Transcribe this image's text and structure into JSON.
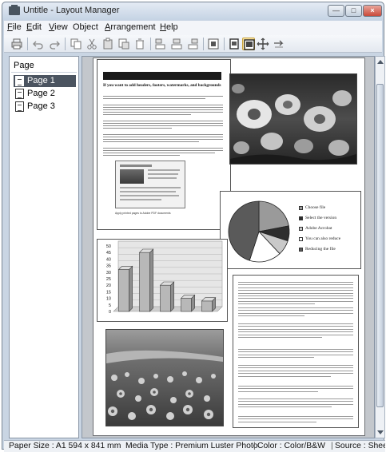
{
  "window": {
    "title": "Untitle - Layout Manager",
    "controls": [
      "min",
      "max",
      "close"
    ]
  },
  "menu": {
    "items": [
      {
        "label": "File",
        "hotkey": "F",
        "rest": "ile"
      },
      {
        "label": "Edit",
        "hotkey": "E",
        "rest": "dit"
      },
      {
        "label": "View",
        "hotkey": "V",
        "rest": "iew"
      },
      {
        "label": "Object",
        "hotkey": "",
        "rest": "Object",
        "hotkey_after": "j"
      },
      {
        "label": "Arrangement",
        "hotkey": "A",
        "rest": "rrangement"
      },
      {
        "label": "Help",
        "hotkey": "H",
        "rest": "elp"
      }
    ]
  },
  "toolbar": {
    "buttons": [
      {
        "name": "print-icon",
        "active": false
      },
      {
        "name": "undo-icon",
        "active": false
      },
      {
        "name": "redo-icon",
        "active": false
      },
      {
        "name": "copy-icon",
        "active": false
      },
      {
        "name": "cut-icon",
        "active": false
      },
      {
        "name": "paste-icon",
        "active": false
      },
      {
        "name": "paste-special-icon",
        "active": false
      },
      {
        "name": "delete-icon",
        "active": false
      },
      {
        "name": "align-left-icon",
        "active": false
      },
      {
        "name": "align-center-icon",
        "active": false
      },
      {
        "name": "align-right-icon",
        "active": false
      },
      {
        "name": "fit-page-icon",
        "active": false
      },
      {
        "name": "page-view-icon",
        "active": false
      },
      {
        "name": "layout-view-icon",
        "active": true
      },
      {
        "name": "zoom-icon",
        "active": false
      },
      {
        "name": "pan-icon",
        "active": false
      }
    ]
  },
  "sidebar": {
    "title": "Page",
    "pages": [
      {
        "label": "Page 1",
        "selected": true
      },
      {
        "label": "Page 2",
        "selected": false
      },
      {
        "label": "Page 3",
        "selected": false
      }
    ]
  },
  "document": {
    "heading": "If you want to add headers, footers, watermarks, and backgrounds",
    "caption": "Apply printed pages to Adobe PDF documents",
    "pie_legend": [
      "Choose file",
      "Select the version",
      "Adobe Acrobat",
      "You can also reduce",
      "Reducing the file"
    ],
    "colors": {
      "pie": [
        "#9a9a9a",
        "#2e2e2e",
        "#c9c9c9",
        "#ffffff",
        "#5a5a5a"
      ],
      "bars": "#b8b8b8"
    }
  },
  "chart_data": {
    "type": "bar",
    "categories": [
      "1",
      "2",
      "3",
      "4",
      "5"
    ],
    "values": [
      32,
      45,
      20,
      10,
      8
    ],
    "title": "",
    "xlabel": "",
    "ylabel": "",
    "ylim": [
      0,
      50
    ],
    "yticks": [
      0,
      5,
      10,
      15,
      20,
      25,
      30,
      35,
      40,
      45,
      50
    ],
    "grid": true,
    "legend": "none"
  },
  "statusbar": {
    "paper_size": "Paper Size : A1 594 x 841 mm",
    "media_type": "Media Type : Premium Luster Photo",
    "color": "Color : Color/B&W",
    "source": "Source : Sheet"
  }
}
